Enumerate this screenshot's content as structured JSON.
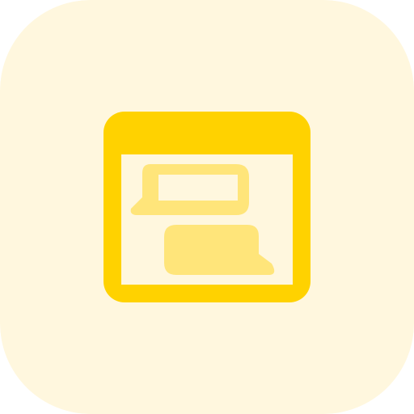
{
  "icon": {
    "name": "browser-chat-icon",
    "colors": {
      "background": "#FFF7DE",
      "frame": "#FFD200",
      "bubble": "#FFE57A",
      "window_fill": "#FFF7DE"
    }
  }
}
